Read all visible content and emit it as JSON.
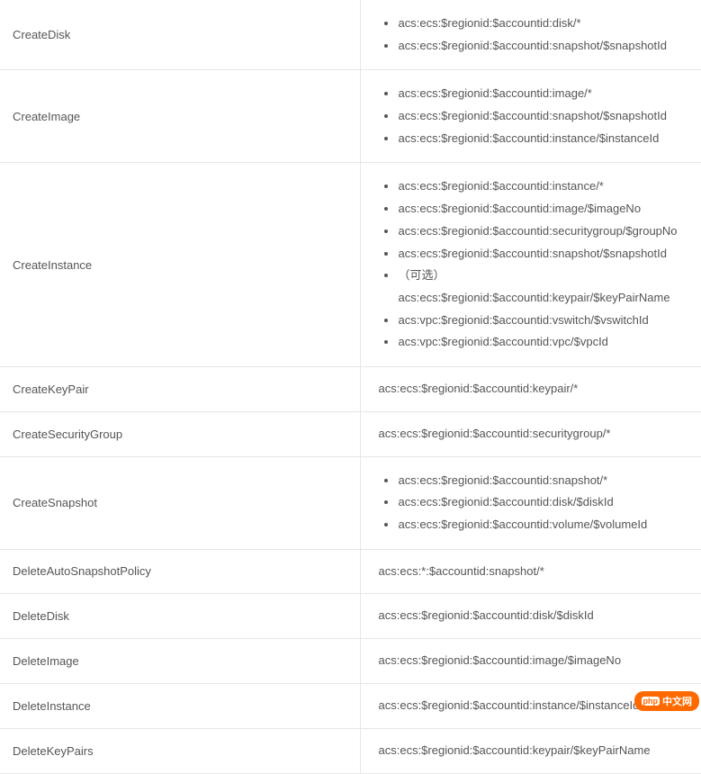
{
  "rows": [
    {
      "action": "CreateDisk",
      "resources": [
        "acs:ecs:$regionid:$accountid:disk/*",
        "acs:ecs:$regionid:$accountid:snapshot/$snapshotId"
      ],
      "list": true
    },
    {
      "action": "CreateImage",
      "resources": [
        "acs:ecs:$regionid:$accountid:image/*",
        "acs:ecs:$regionid:$accountid:snapshot/$snapshotId",
        "acs:ecs:$regionid:$accountid:instance/$instanceId"
      ],
      "list": true
    },
    {
      "action": "CreateInstance",
      "resources": [
        "acs:ecs:$regionid:$accountid:instance/*",
        "acs:ecs:$regionid:$accountid:image/$imageNo",
        "acs:ecs:$regionid:$accountid:securitygroup/$groupNo",
        "acs:ecs:$regionid:$accountid:snapshot/$snapshotId",
        "（可选）acs:ecs:$regionid:$accountid:keypair/$keyPairName",
        "acs:vpc:$regionid:$accountid:vswitch/$vswitchId",
        "acs:vpc:$regionid:$accountid:vpc/$vpcId"
      ],
      "list": true
    },
    {
      "action": "CreateKeyPair",
      "resources": [
        "acs:ecs:$regionid:$accountid:keypair/*"
      ],
      "list": false
    },
    {
      "action": "CreateSecurityGroup",
      "resources": [
        "acs:ecs:$regionid:$accountid:securitygroup/*"
      ],
      "list": false
    },
    {
      "action": "CreateSnapshot",
      "resources": [
        "acs:ecs:$regionid:$accountid:snapshot/*",
        "acs:ecs:$regionid:$accountid:disk/$diskId",
        "acs:ecs:$regionid:$accountid:volume/$volumeId"
      ],
      "list": true
    },
    {
      "action": "DeleteAutoSnapshotPolicy",
      "resources": [
        "acs:ecs:*:$accountid:snapshot/*"
      ],
      "list": false
    },
    {
      "action": "DeleteDisk",
      "resources": [
        "acs:ecs:$regionid:$accountid:disk/$diskId"
      ],
      "list": false
    },
    {
      "action": "DeleteImage",
      "resources": [
        "acs:ecs:$regionid:$accountid:image/$imageNo"
      ],
      "list": false
    },
    {
      "action": "DeleteInstance",
      "resources": [
        "acs:ecs:$regionid:$accountid:instance/$instanceId"
      ],
      "list": false
    },
    {
      "action": "DeleteKeyPairs",
      "resources": [
        "acs:ecs:$regionid:$accountid:keypair/$keyPairName"
      ],
      "list": false
    }
  ],
  "watermark": {
    "icon": "php",
    "text": "中文网"
  }
}
